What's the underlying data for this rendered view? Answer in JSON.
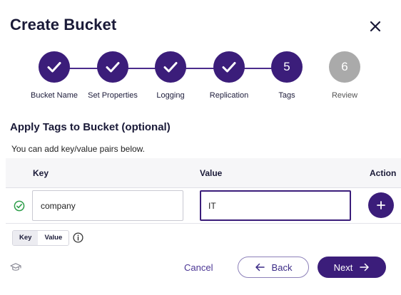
{
  "dialog": {
    "title": "Create Bucket",
    "close_icon": "close-icon"
  },
  "stepper": {
    "steps": [
      {
        "label": "Bucket Name",
        "state": "done"
      },
      {
        "label": "Set Properties",
        "state": "done"
      },
      {
        "label": "Logging",
        "state": "done"
      },
      {
        "label": "Replication",
        "state": "done"
      },
      {
        "label": "Tags",
        "state": "current",
        "number": "5"
      },
      {
        "label": "Review",
        "state": "future",
        "number": "6"
      }
    ]
  },
  "section": {
    "title": "Apply Tags to Bucket (optional)",
    "hint": "You can add key/value pairs below."
  },
  "table": {
    "headers": {
      "key": "Key",
      "value": "Value",
      "action": "Action"
    },
    "rows": [
      {
        "key": "company",
        "value": "IT",
        "valid": true
      }
    ]
  },
  "toggle": {
    "key_label": "Key",
    "value_label": "Value",
    "selected": "Key"
  },
  "footer": {
    "cancel": "Cancel",
    "back": "Back",
    "next": "Next"
  },
  "colors": {
    "primary": "#3b1d7a",
    "future_step": "#aaaaaa",
    "success": "#2e9e4a"
  }
}
